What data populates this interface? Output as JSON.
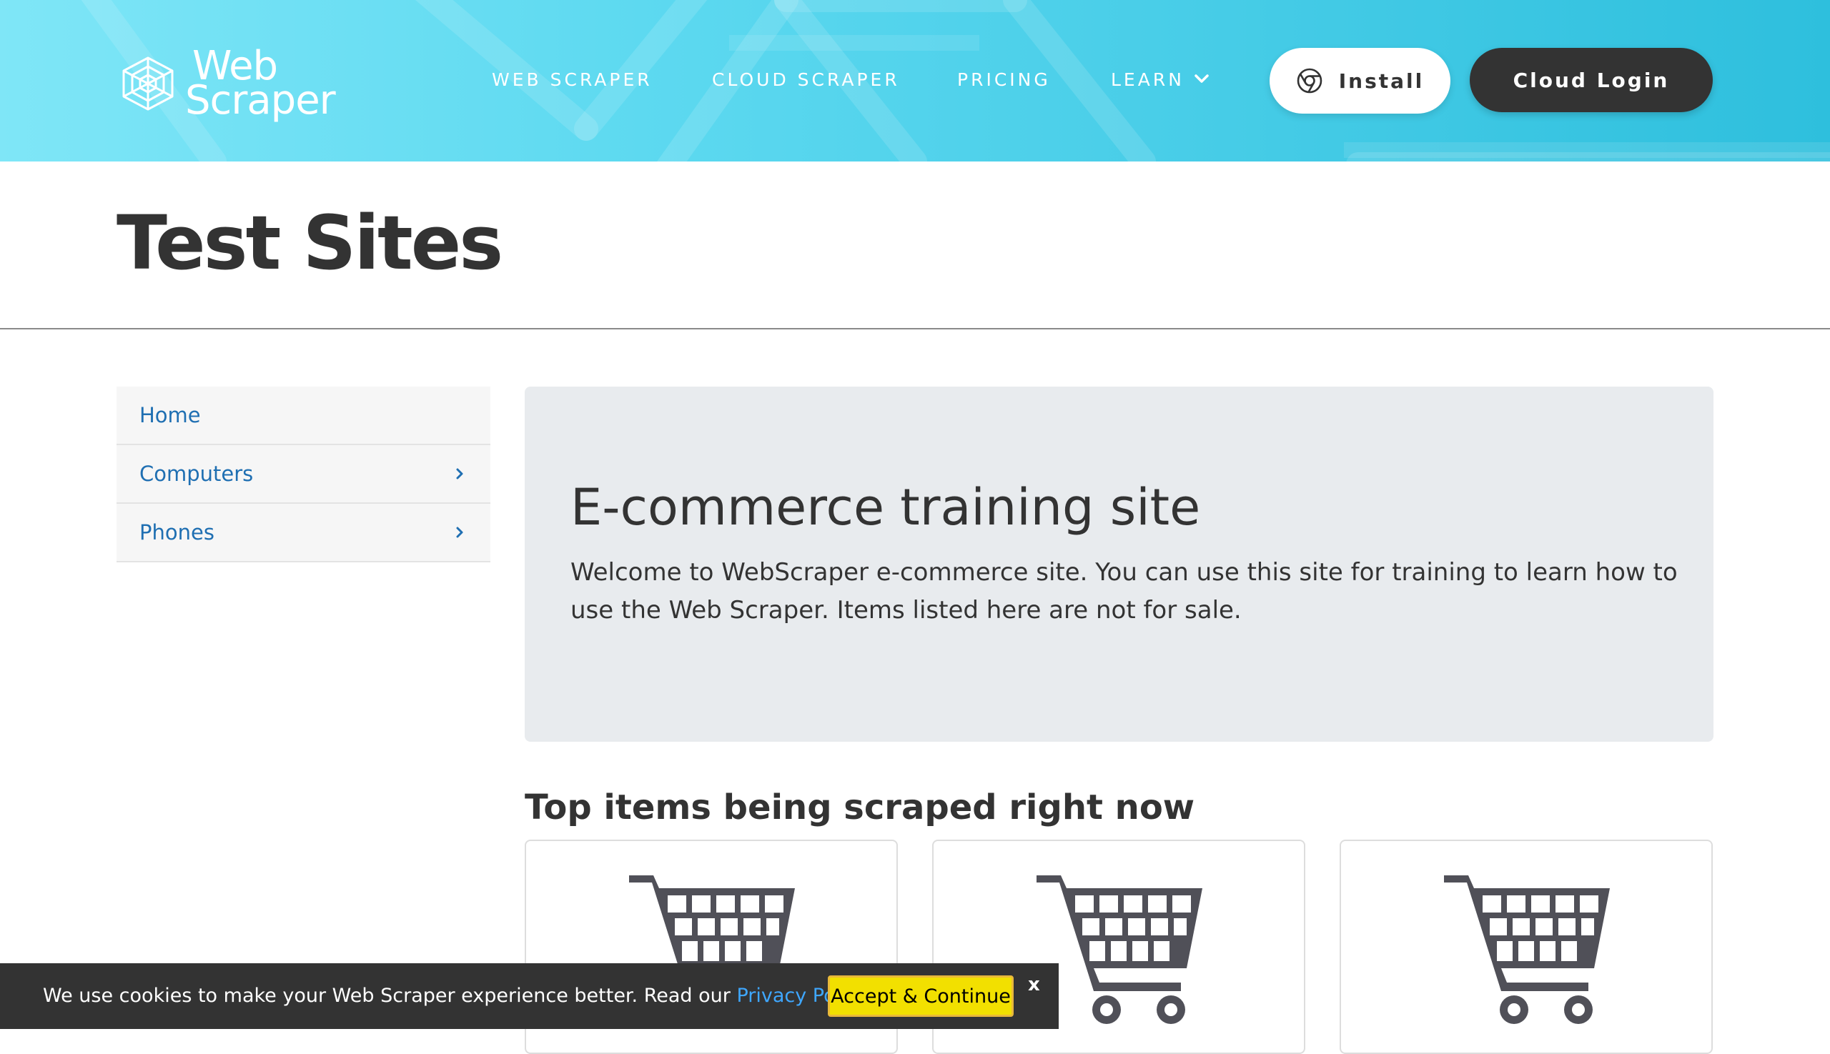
{
  "header": {
    "logo": {
      "line1": "Web",
      "line2": "Scraper"
    },
    "nav": [
      {
        "label": "WEB SCRAPER"
      },
      {
        "label": "CLOUD SCRAPER"
      },
      {
        "label": "PRICING"
      },
      {
        "label": "LEARN"
      }
    ],
    "install_label": "Install",
    "cloud_login_label": "Cloud Login"
  },
  "page_title": "Test Sites",
  "sidebar": {
    "items": [
      {
        "label": "Home",
        "has_submenu": false
      },
      {
        "label": "Computers",
        "has_submenu": true
      },
      {
        "label": "Phones",
        "has_submenu": true
      }
    ]
  },
  "jumbotron": {
    "heading": "E-commerce training site",
    "text": "Welcome to WebScraper e-commerce site. You can use this site for training to learn how to use the Web Scraper. Items listed here are not for sale."
  },
  "top_items": {
    "heading": "Top items being scraped right now",
    "cards": [
      {
        "icon": "shopping-cart-icon"
      },
      {
        "icon": "shopping-cart-icon"
      },
      {
        "icon": "shopping-cart-icon"
      }
    ]
  },
  "cookie_bar": {
    "message_before": "We use cookies to make your Web Scraper experience better. Read our ",
    "policy_link": "Privacy Policy",
    "message_after": ".",
    "accept_label": "Accept & Continue",
    "close_label": "x"
  },
  "colors": {
    "header_gradient_start": "#7fe6f7",
    "header_gradient_end": "#2ebfdd",
    "text_dark": "#333333",
    "link_blue": "#1f6fb2",
    "jumbotron_bg": "#e8ebee",
    "cookie_bg": "#333333",
    "accept_yellow": "#f2e000",
    "cart_gray": "#505058"
  }
}
